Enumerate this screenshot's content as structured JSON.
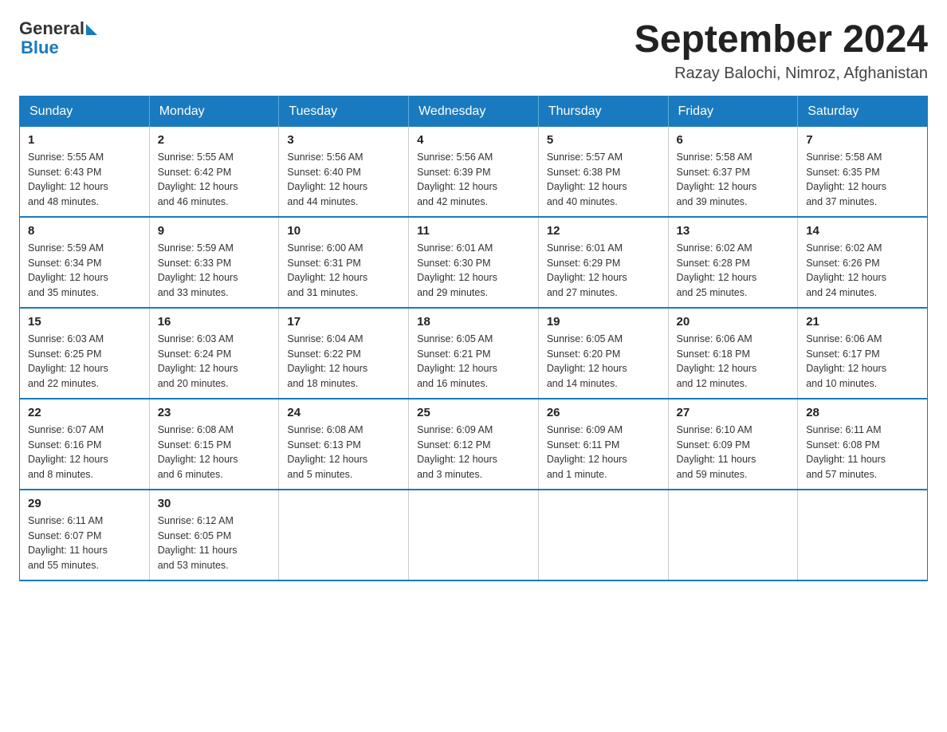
{
  "logo": {
    "general": "General",
    "blue": "Blue"
  },
  "title": "September 2024",
  "subtitle": "Razay Balochi, Nimroz, Afghanistan",
  "weekdays": [
    "Sunday",
    "Monday",
    "Tuesday",
    "Wednesday",
    "Thursday",
    "Friday",
    "Saturday"
  ],
  "weeks": [
    [
      {
        "day": "1",
        "sunrise": "5:55 AM",
        "sunset": "6:43 PM",
        "daylight": "12 hours and 48 minutes."
      },
      {
        "day": "2",
        "sunrise": "5:55 AM",
        "sunset": "6:42 PM",
        "daylight": "12 hours and 46 minutes."
      },
      {
        "day": "3",
        "sunrise": "5:56 AM",
        "sunset": "6:40 PM",
        "daylight": "12 hours and 44 minutes."
      },
      {
        "day": "4",
        "sunrise": "5:56 AM",
        "sunset": "6:39 PM",
        "daylight": "12 hours and 42 minutes."
      },
      {
        "day": "5",
        "sunrise": "5:57 AM",
        "sunset": "6:38 PM",
        "daylight": "12 hours and 40 minutes."
      },
      {
        "day": "6",
        "sunrise": "5:58 AM",
        "sunset": "6:37 PM",
        "daylight": "12 hours and 39 minutes."
      },
      {
        "day": "7",
        "sunrise": "5:58 AM",
        "sunset": "6:35 PM",
        "daylight": "12 hours and 37 minutes."
      }
    ],
    [
      {
        "day": "8",
        "sunrise": "5:59 AM",
        "sunset": "6:34 PM",
        "daylight": "12 hours and 35 minutes."
      },
      {
        "day": "9",
        "sunrise": "5:59 AM",
        "sunset": "6:33 PM",
        "daylight": "12 hours and 33 minutes."
      },
      {
        "day": "10",
        "sunrise": "6:00 AM",
        "sunset": "6:31 PM",
        "daylight": "12 hours and 31 minutes."
      },
      {
        "day": "11",
        "sunrise": "6:01 AM",
        "sunset": "6:30 PM",
        "daylight": "12 hours and 29 minutes."
      },
      {
        "day": "12",
        "sunrise": "6:01 AM",
        "sunset": "6:29 PM",
        "daylight": "12 hours and 27 minutes."
      },
      {
        "day": "13",
        "sunrise": "6:02 AM",
        "sunset": "6:28 PM",
        "daylight": "12 hours and 25 minutes."
      },
      {
        "day": "14",
        "sunrise": "6:02 AM",
        "sunset": "6:26 PM",
        "daylight": "12 hours and 24 minutes."
      }
    ],
    [
      {
        "day": "15",
        "sunrise": "6:03 AM",
        "sunset": "6:25 PM",
        "daylight": "12 hours and 22 minutes."
      },
      {
        "day": "16",
        "sunrise": "6:03 AM",
        "sunset": "6:24 PM",
        "daylight": "12 hours and 20 minutes."
      },
      {
        "day": "17",
        "sunrise": "6:04 AM",
        "sunset": "6:22 PM",
        "daylight": "12 hours and 18 minutes."
      },
      {
        "day": "18",
        "sunrise": "6:05 AM",
        "sunset": "6:21 PM",
        "daylight": "12 hours and 16 minutes."
      },
      {
        "day": "19",
        "sunrise": "6:05 AM",
        "sunset": "6:20 PM",
        "daylight": "12 hours and 14 minutes."
      },
      {
        "day": "20",
        "sunrise": "6:06 AM",
        "sunset": "6:18 PM",
        "daylight": "12 hours and 12 minutes."
      },
      {
        "day": "21",
        "sunrise": "6:06 AM",
        "sunset": "6:17 PM",
        "daylight": "12 hours and 10 minutes."
      }
    ],
    [
      {
        "day": "22",
        "sunrise": "6:07 AM",
        "sunset": "6:16 PM",
        "daylight": "12 hours and 8 minutes."
      },
      {
        "day": "23",
        "sunrise": "6:08 AM",
        "sunset": "6:15 PM",
        "daylight": "12 hours and 6 minutes."
      },
      {
        "day": "24",
        "sunrise": "6:08 AM",
        "sunset": "6:13 PM",
        "daylight": "12 hours and 5 minutes."
      },
      {
        "day": "25",
        "sunrise": "6:09 AM",
        "sunset": "6:12 PM",
        "daylight": "12 hours and 3 minutes."
      },
      {
        "day": "26",
        "sunrise": "6:09 AM",
        "sunset": "6:11 PM",
        "daylight": "12 hours and 1 minute."
      },
      {
        "day": "27",
        "sunrise": "6:10 AM",
        "sunset": "6:09 PM",
        "daylight": "11 hours and 59 minutes."
      },
      {
        "day": "28",
        "sunrise": "6:11 AM",
        "sunset": "6:08 PM",
        "daylight": "11 hours and 57 minutes."
      }
    ],
    [
      {
        "day": "29",
        "sunrise": "6:11 AM",
        "sunset": "6:07 PM",
        "daylight": "11 hours and 55 minutes."
      },
      {
        "day": "30",
        "sunrise": "6:12 AM",
        "sunset": "6:05 PM",
        "daylight": "11 hours and 53 minutes."
      },
      null,
      null,
      null,
      null,
      null
    ]
  ],
  "labels": {
    "sunrise": "Sunrise:",
    "sunset": "Sunset:",
    "daylight": "Daylight:"
  }
}
